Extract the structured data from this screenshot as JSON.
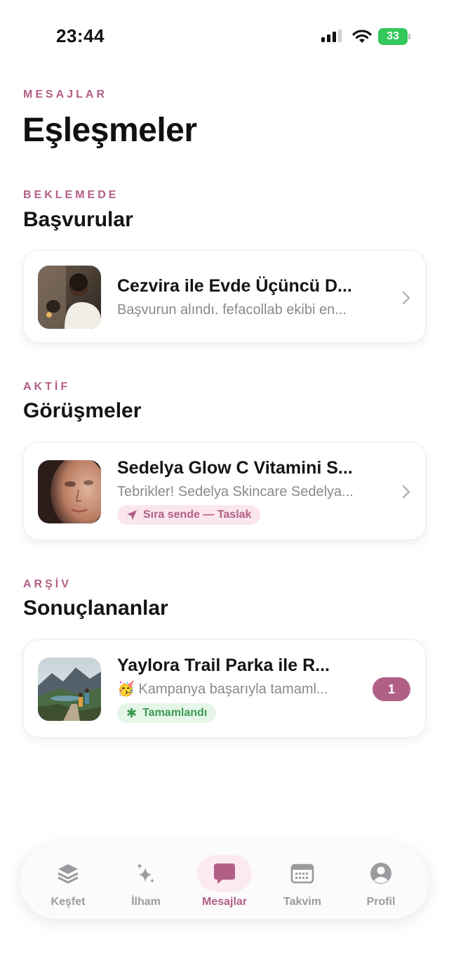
{
  "status_bar": {
    "time": "23:44",
    "battery": "33"
  },
  "header": {
    "eyebrow": "MESAJLAR",
    "title": "Eşleşmeler"
  },
  "sections": [
    {
      "eyebrow": "BEKLEMEDE",
      "title": "Başvurular",
      "cards": [
        {
          "title": "Cezvira ile Evde Üçüncü D...",
          "subtitle": "Başvurun alındı. fefacollab ekibi en..."
        }
      ]
    },
    {
      "eyebrow": "AKTİF",
      "title": "Görüşmeler",
      "cards": [
        {
          "title": "Sedelya Glow C Vitamini S...",
          "subtitle": "Tebrikler! Sedelya Skincare Sedelya...",
          "pill": "Sıra sende — Taslak"
        }
      ]
    },
    {
      "eyebrow": "ARŞİV",
      "title": "Sonuçlananlar",
      "cards": [
        {
          "title": "Yaylora Trail Parka ile R...",
          "subtitle_emoji": "🥳",
          "subtitle": "Kampanya başarıyla tamaml...",
          "pill": "Tamamlandı",
          "badge": "1"
        }
      ]
    }
  ],
  "tabbar": {
    "active": "Mesajlar",
    "tabs": [
      {
        "label": "Keşfet",
        "icon": "layers-icon"
      },
      {
        "label": "İlham",
        "icon": "sparkles-icon"
      },
      {
        "label": "Mesajlar",
        "icon": "message-icon"
      },
      {
        "label": "Takvim",
        "icon": "calendar-icon"
      },
      {
        "label": "Profil",
        "icon": "profile-icon"
      }
    ]
  },
  "colors": {
    "accent": "#b25f87",
    "success": "#3a9b4f",
    "battery": "#34c759"
  }
}
